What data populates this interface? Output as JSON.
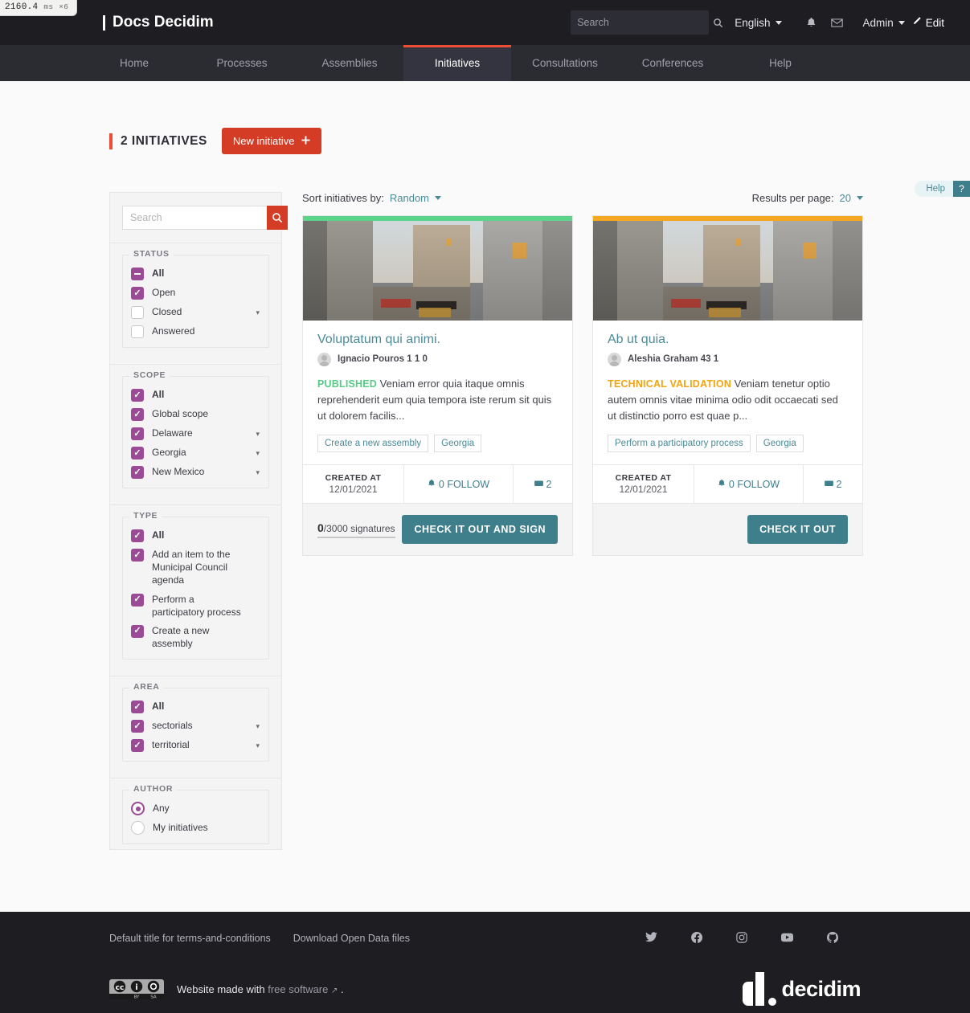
{
  "perf": {
    "value": "2160.4",
    "unit": "ms",
    "mult": "×6"
  },
  "header": {
    "brand": "Docs Decidim",
    "search_placeholder": "Search",
    "search_value": "",
    "language": "English",
    "user": "Admin",
    "edit": "Edit",
    "icons": {
      "search": "search-icon",
      "bell": "bell-icon",
      "mail": "mail-icon",
      "pencil": "pencil-icon"
    }
  },
  "nav": {
    "items": [
      {
        "label": "Home",
        "active": false
      },
      {
        "label": "Processes",
        "active": false
      },
      {
        "label": "Assemblies",
        "active": false
      },
      {
        "label": "Initiatives",
        "active": true
      },
      {
        "label": "Consultations",
        "active": false
      },
      {
        "label": "Conferences",
        "active": false
      },
      {
        "label": "Help",
        "active": false
      }
    ]
  },
  "help_pill": {
    "label": "Help",
    "mark": "?"
  },
  "page_title": "2 INITIATIVES",
  "new_initiative_button": "New initiative",
  "sidebar": {
    "search_placeholder": "Search",
    "search_value": "",
    "groups": [
      {
        "legend": "STATUS",
        "items": [
          {
            "label": "All",
            "state": "indeterminate",
            "bold": true,
            "chevron": false
          },
          {
            "label": "Open",
            "state": "checked",
            "bold": false,
            "chevron": false
          },
          {
            "label": "Closed",
            "state": "unchecked",
            "bold": false,
            "chevron": true
          },
          {
            "label": "Answered",
            "state": "unchecked",
            "bold": false,
            "chevron": false
          }
        ]
      },
      {
        "legend": "SCOPE",
        "items": [
          {
            "label": "All",
            "state": "checked",
            "bold": true,
            "chevron": false
          },
          {
            "label": "Global scope",
            "state": "checked",
            "bold": false,
            "chevron": false
          },
          {
            "label": "Delaware",
            "state": "checked",
            "bold": false,
            "chevron": true
          },
          {
            "label": "Georgia",
            "state": "checked",
            "bold": false,
            "chevron": true
          },
          {
            "label": "New Mexico",
            "state": "checked",
            "bold": false,
            "chevron": true
          }
        ]
      },
      {
        "legend": "TYPE",
        "items": [
          {
            "label": "All",
            "state": "checked",
            "bold": true,
            "chevron": false
          },
          {
            "label": "Add an item to the Municipal Council agenda",
            "state": "checked",
            "bold": false,
            "chevron": false
          },
          {
            "label": "Perform a participatory process",
            "state": "checked",
            "bold": false,
            "chevron": false
          },
          {
            "label": "Create a new assembly",
            "state": "checked",
            "bold": false,
            "chevron": false
          }
        ]
      },
      {
        "legend": "AREA",
        "items": [
          {
            "label": "All",
            "state": "checked",
            "bold": true,
            "chevron": false
          },
          {
            "label": "sectorials",
            "state": "checked",
            "bold": false,
            "chevron": true
          },
          {
            "label": "territorial",
            "state": "checked",
            "bold": false,
            "chevron": true
          }
        ]
      }
    ],
    "author": {
      "legend": "AUTHOR",
      "options": [
        {
          "label": "Any",
          "selected": true
        },
        {
          "label": "My initiatives",
          "selected": false
        }
      ]
    }
  },
  "controls": {
    "sort_label": "Sort initiatives by:",
    "sort_value": "Random",
    "per_page_label": "Results per page:",
    "per_page_value": "20"
  },
  "cards": [
    {
      "stripe_color": "#5cd48a",
      "title": "Voluptatum qui animi.",
      "author": "Ignacio Pouros 1 1 0",
      "status": "PUBLISHED",
      "status_class": "st-published",
      "excerpt": "Veniam error quia itaque omnis reprehenderit eum quia tempora iste rerum sit quis ut dolorem facilis...",
      "tags": [
        "Create a new assembly",
        "Georgia"
      ],
      "created_label": "CREATED AT",
      "created_at": "12/01/2021",
      "follow": "0 FOLLOW",
      "comments": "2",
      "signatures_count": "0",
      "signatures_total": "/3000 signatures",
      "action": "CHECK IT OUT AND SIGN",
      "has_signatures": true
    },
    {
      "stripe_color": "#f5a623",
      "title": "Ab ut quia.",
      "author": "Aleshia Graham 43 1",
      "status": "TECHNICAL VALIDATION",
      "status_class": "st-technical",
      "excerpt": "Veniam tenetur optio autem omnis vitae minima odio odit occaecati sed ut distinctio porro est quae p...",
      "tags": [
        "Perform a participatory process",
        "Georgia"
      ],
      "created_label": "CREATED AT",
      "created_at": "12/01/2021",
      "follow": "0 FOLLOW",
      "comments": "2",
      "signatures_count": "",
      "signatures_total": "",
      "action": "CHECK IT OUT",
      "has_signatures": false
    }
  ],
  "footer": {
    "links": [
      "Default title for terms-and-conditions",
      "Download Open Data files"
    ],
    "social": [
      "twitter-icon",
      "facebook-icon",
      "instagram-icon",
      "youtube-icon",
      "github-icon"
    ],
    "made_with_prefix": "Website made with",
    "made_with_link": "free software",
    "made_with_suffix": ".",
    "logo": "decidim"
  },
  "colors": {
    "brand_red": "#d43c26",
    "accent_teal": "#3f7f8c",
    "purple": "#9b4a96",
    "green": "#57cb85",
    "orange": "#f2a413"
  }
}
